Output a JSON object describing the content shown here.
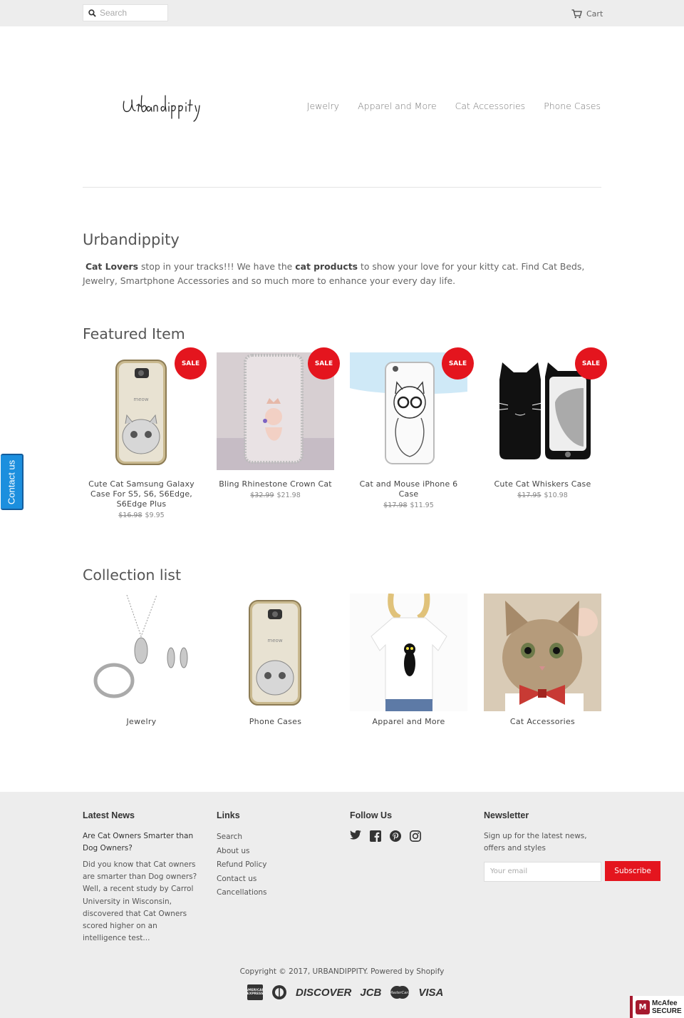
{
  "topbar": {
    "search_placeholder": "Search",
    "cart_label": "Cart"
  },
  "header": {
    "logo_text": "Urbandippity",
    "nav": [
      "Jewelry",
      "Apparel and More",
      "Cat Accessories",
      "Phone Cases"
    ]
  },
  "intro": {
    "title": "Urbandippity",
    "bold1": "Cat Lovers",
    "text1": " stop in your tracks!!! We have the ",
    "bold2": "cat products",
    "text2": " to show your love for your kitty cat. Find Cat Beds, Jewelry, Smartphone Accessories and so much more to enhance your every day life."
  },
  "featured": {
    "heading": "Featured Item",
    "sale_badge": "SALE",
    "products": [
      {
        "title": "Cute Cat Samsung Galaxy Case For S5, S6, S6Edge, S6Edge Plus",
        "old_price": "$16.98",
        "price": "$9.95"
      },
      {
        "title": "Bling Rhinestone Crown Cat",
        "old_price": "$32.99",
        "price": "$21.98"
      },
      {
        "title": "Cat and Mouse iPhone 6 Case",
        "old_price": "$17.98",
        "price": "$11.95"
      },
      {
        "title": "Cute Cat Whiskers Case",
        "old_price": "$17.95",
        "price": "$10.98"
      }
    ]
  },
  "collections": {
    "heading": "Collection list",
    "items": [
      "Jewelry",
      "Phone Cases",
      "Apparel and More",
      "Cat Accessories"
    ]
  },
  "contact_tab": "Contact us",
  "footer": {
    "news": {
      "heading": "Latest News",
      "post_title": "Are Cat Owners Smarter than Dog Owners?",
      "post_excerpt": "Did you know that Cat owners are smarter than Dog owners? Well, a recent study by Carrol University in Wisconsin, discovered that Cat Owners scored higher on an intelligence test..."
    },
    "links": {
      "heading": "Links",
      "items": [
        "Search",
        "About us",
        "Refund Policy",
        "Contact us",
        "Cancellations"
      ]
    },
    "follow": {
      "heading": "Follow Us",
      "icons": [
        "twitter-icon",
        "facebook-icon",
        "pinterest-icon",
        "instagram-icon"
      ]
    },
    "newsletter": {
      "heading": "Newsletter",
      "text": "Sign up for the latest news, offers and styles",
      "placeholder": "Your email",
      "button": "Subscribe"
    },
    "copyright": "Copyright © 2017, URBANDIPPITY. Powered by Shopify",
    "payments": [
      "american-express",
      "diners-club",
      "DISCOVER",
      "JCB",
      "MasterCard",
      "VISA"
    ]
  },
  "badge": {
    "line1": "McAfee",
    "line2": "SECURE"
  },
  "colors": {
    "accent_red": "#e4151e",
    "topbar_bg": "#ededed",
    "contact_blue": "#1c8fde"
  }
}
